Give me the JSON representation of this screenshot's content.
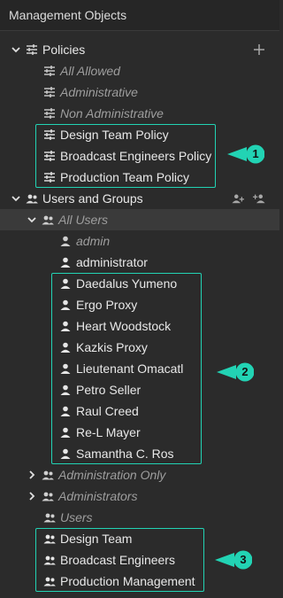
{
  "panel": {
    "title": "Management Objects"
  },
  "tree": {
    "policies": {
      "label": "Policies",
      "children": [
        "All Allowed",
        "Administrative",
        "Non Administrative",
        "Design Team Policy",
        "Broadcast Engineers Policy",
        "Production Team Policy"
      ]
    },
    "users_groups": {
      "label": "Users and Groups",
      "all_users": {
        "label": "All Users",
        "children": [
          "admin",
          "administrator",
          "Daedalus Yumeno",
          "Ergo Proxy",
          "Heart Woodstock",
          "Kazkis Proxy",
          "Lieutenant Omacatl",
          "Petro Seller",
          "Raul Creed",
          "Re-L Mayer",
          "Samantha C. Ros"
        ]
      },
      "groups": [
        "Administration Only",
        "Administrators",
        "Users",
        "Design Team",
        "Broadcast Engineers",
        "Production Management"
      ]
    }
  },
  "callouts": [
    "1",
    "2",
    "3"
  ],
  "colors": {
    "accent": "#22d3b4",
    "background": "#2b2b2b",
    "selected": "#3a3a3a"
  },
  "icons": {
    "policy": "sliders-icon",
    "user": "person-icon",
    "group": "group-icon",
    "add": "plus-icon",
    "add_user": "add-user-icon"
  }
}
